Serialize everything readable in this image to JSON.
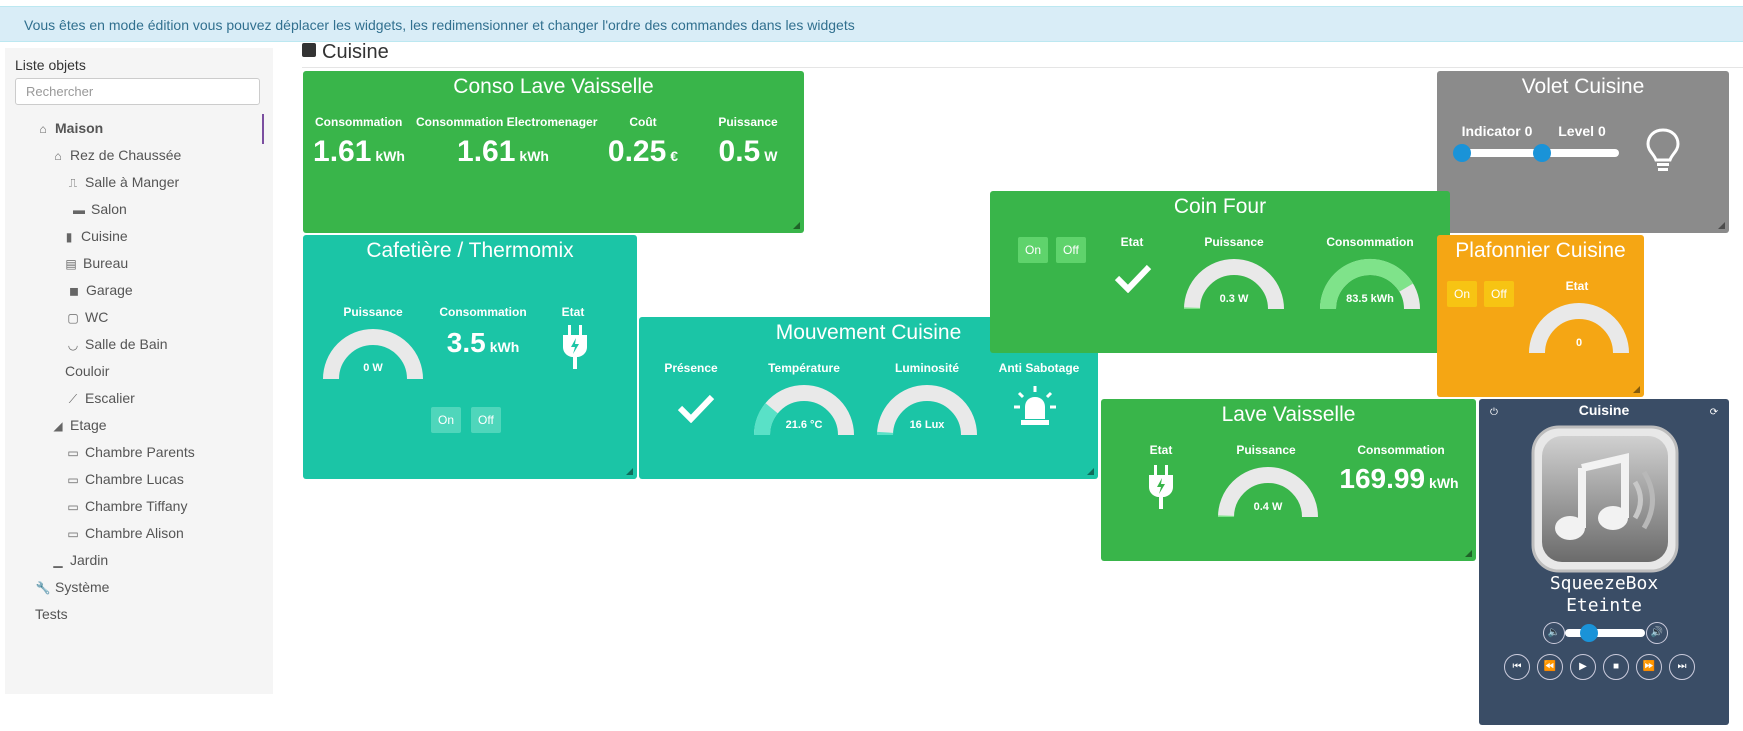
{
  "banner": {
    "text": "Vous êtes en mode édition vous pouvez déplacer les widgets, les redimensionner et changer l'ordre des commandes dans les widgets"
  },
  "sidebar": {
    "title": "Liste objets",
    "search_placeholder": "Rechercher",
    "items": [
      {
        "label": "Maison",
        "icon": "house-icon"
      },
      {
        "label": "Rez de Chaussée",
        "icon": "home-icon"
      },
      {
        "label": "Salle à Manger",
        "icon": "dining-icon"
      },
      {
        "label": "Salon",
        "icon": "sofa-icon"
      },
      {
        "label": "Cuisine",
        "icon": "kitchen-icon"
      },
      {
        "label": "Bureau",
        "icon": "desk-icon"
      },
      {
        "label": "Garage",
        "icon": "car-icon"
      },
      {
        "label": "WC",
        "icon": "toilet-icon"
      },
      {
        "label": "Salle de Bain",
        "icon": "bath-icon"
      },
      {
        "label": "Couloir",
        "icon": ""
      },
      {
        "label": "Escalier",
        "icon": "stairs-icon"
      },
      {
        "label": "Etage",
        "icon": "floor-icon"
      },
      {
        "label": "Chambre Parents",
        "icon": "bed-icon"
      },
      {
        "label": "Chambre Lucas",
        "icon": "bed-icon"
      },
      {
        "label": "Chambre Tiffany",
        "icon": "bed-icon"
      },
      {
        "label": "Chambre Alison",
        "icon": "bed-icon"
      },
      {
        "label": "Jardin",
        "icon": "garden-icon"
      },
      {
        "label": "Système",
        "icon": "wrench-icon"
      },
      {
        "label": "Tests",
        "icon": ""
      }
    ]
  },
  "page": {
    "title": "Cuisine"
  },
  "conso": {
    "title": "Conso Lave Vaisselle",
    "cmds": [
      {
        "label": "Consommation",
        "value": "1.61",
        "unit": "kWh"
      },
      {
        "label": "Consommation Electromenager",
        "value": "1.61",
        "unit": "kWh"
      },
      {
        "label": "Coût",
        "value": "0.25",
        "unit": "€"
      },
      {
        "label": "Puissance",
        "value": "0.5",
        "unit": "W"
      }
    ]
  },
  "volet": {
    "title": "Volet Cuisine",
    "indicator_label": "Indicator 0",
    "level_label": "Level 0",
    "indicator": 0,
    "level": 0
  },
  "cafetiere": {
    "title": "Cafetière / Thermomix",
    "puissance_label": "Puissance",
    "puissance_value": "0 W",
    "puissance": 0,
    "conso_label": "Consommation",
    "conso_value": "3.5",
    "conso_unit": "kWh",
    "etat_label": "Etat",
    "on": "On",
    "off": "Off"
  },
  "coinfour": {
    "title": "Coin Four",
    "on": "On",
    "off": "Off",
    "etat_label": "Etat",
    "puissance_label": "Puissance",
    "puissance_value": "0.3 W",
    "puissance": 0.01,
    "conso_label": "Consommation",
    "conso_value": "83.5 kWh",
    "conso": 0.83
  },
  "plafonnier": {
    "title": "Plafonnier Cuisine",
    "on": "On",
    "off": "Off",
    "etat_label": "Etat",
    "etat_value": "0",
    "etat": 0
  },
  "mouvement": {
    "title": "Mouvement Cuisine",
    "presence_label": "Présence",
    "temp_label": "Température",
    "temp_value": "21.6 °C",
    "temp": 0.22,
    "lum_label": "Luminosité",
    "lum_value": "16 Lux",
    "lum": 0.02,
    "sabotage_label": "Anti Sabotage"
  },
  "lave": {
    "title": "Lave Vaisselle",
    "etat_label": "Etat",
    "puissance_label": "Puissance",
    "puissance_value": "0.4 W",
    "puissance": 0.01,
    "conso_label": "Consommation",
    "conso_value": "169.99",
    "conso_unit": "kWh"
  },
  "player": {
    "title": "Cuisine",
    "line1": "SqueezeBox",
    "line2": "Eteinte",
    "volume": 0.3
  },
  "colors": {
    "green": "#39b54a",
    "teal": "#1bc5a6",
    "grey": "#8b8b8b",
    "orange": "#f5a614",
    "navy": "#3a4d66"
  }
}
